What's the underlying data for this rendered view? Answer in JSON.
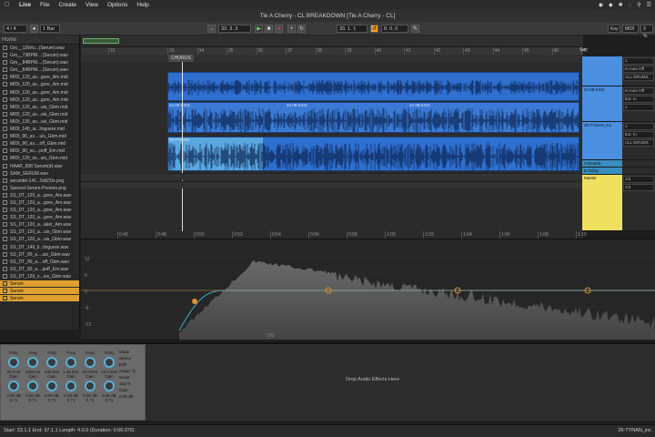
{
  "menubar": {
    "app": "Live",
    "items": [
      "File",
      "Create",
      "View",
      "Options",
      "Help"
    ]
  },
  "window": {
    "title": "Tie A Cherry - CL BREAKDOWN  [Tie A Cherry - CL]"
  },
  "transport": {
    "signature": "4 / 4",
    "quantize": "1 Bar",
    "position": "33.  3.  3",
    "loop_start": "33.  1.  1",
    "loop_length": "8.  0.  0",
    "key_label": "Key",
    "midi_label": "MIDI",
    "cpu": "3 %"
  },
  "browser": {
    "place": "Home",
    "items": [
      "Gm__126#u...(Serum).wav",
      "Gm__73BPM....(Serum).wav",
      "Gm__84BPM....(Serum).wav",
      "Gm__84BPM....(Serum).wav",
      "MIDI_120_as...gore_Am.mid",
      "MIDI_120_as...gore_Am.mid",
      "MIDI_120_as...gore_Am.mid",
      "MIDI_120_as...gore_Am.mid",
      "MIDI_120_as...uis_Gbm.mid",
      "MIDI_120_as...uis_Gbm.mid",
      "MIDI_130_as...uis_Gbm.mid",
      "MIDI_140_ia...linguere.mid",
      "MIDI_90_as....uis_Gbm.mid",
      "MIDI_90_as....off_Gbm.mid",
      "MIDI_90_ss....poff_Em.mid",
      "MIDI_120_ss...uis_Gbm.mid",
      "HAAR_808 Serum(d).wav",
      "SAM_SERUM.wav",
      "serumkit-141...5dt23lo.png",
      "Speced-Serum-Presets.png",
      "SS_DT_120_a...gore_Am.wav",
      "SS_DT_120_a...gore_Am.wav",
      "SS_DT_120_a...gore_Am.wav",
      "SS_DT_120_a...gore_Am.wav",
      "SS_DT_120_a...aker_Am.wav",
      "SS_DT_120_a...uis_Gbm.wav",
      "SS_DT_120_a...uis_Gbm.wav",
      "SS_DT_140_li...linguere.wav",
      "SS_DT_90_a....uis_Gbm.wav",
      "SS_DT_90_a....off_Gbm.wav",
      "SS_DT_90_a....poff_Em.wav",
      "SS_DT_120_s...uis_Gbm.wav",
      "Serum",
      "Serum",
      "Serum"
    ],
    "selected_index": 32
  },
  "arrangement": {
    "ruler": [
      "31",
      "33",
      "35",
      "37",
      "39",
      "41",
      "43",
      "45",
      "47"
    ],
    "ruler_extra": [
      "34",
      "36",
      "38",
      "40",
      "42",
      "44",
      "46"
    ],
    "locator": "CHORUS",
    "set_label": "Set",
    "clip_labels": {
      "kick_a": "24 08 KICK",
      "kick_b": "24 08 KICK",
      "kick_c": "24 08 KICK",
      "tynan": "26-TYNAN"
    },
    "time_labels": [
      "0:46",
      "0:48",
      "0:50",
      "0:52",
      "0:54",
      "0:56",
      "0:58",
      "1:00",
      "1:02",
      "1:04",
      "1:06",
      "1:08",
      "1:10"
    ]
  },
  "tracks": [
    {
      "name": "",
      "color": "#4a8fe0",
      "in": "In  Auto  Off",
      "route": "ALL DRUMS",
      "num": "1"
    },
    {
      "name": "24 08 KICK",
      "color": "#4a8fe0",
      "in": "Ext. In",
      "route": "1",
      "num": "In  Auto  Off"
    },
    {
      "name": "26-TYNAN_inc",
      "color": "#4a8fe0",
      "in": "Ext. In",
      "route": "ALL DRUMS",
      "num": "1"
    },
    {
      "name": "A Reverb",
      "color": "#3a8ec0",
      "in": "",
      "route": "",
      "num": ""
    },
    {
      "name": "B Delay",
      "color": "#3a8ec0",
      "in": "",
      "route": "",
      "num": ""
    },
    {
      "name": "Master",
      "color": "#f0e060",
      "in": "1/2",
      "route": "1/2",
      "num": ""
    }
  ],
  "eq": {
    "freq_label": "100",
    "db_labels": [
      "12",
      "6",
      "0",
      "-6",
      "-12"
    ]
  },
  "device": {
    "bands": [
      {
        "title": "Freq",
        "freq": "30.0 Hz",
        "gain": "Gain",
        "gval": "0.00 dB",
        "q": "0.71"
      },
      {
        "title": "Freq",
        "freq": "1000 Hz",
        "gain": "Gain",
        "gval": "0.00 dB",
        "q": "0.71"
      },
      {
        "title": "Freq",
        "freq": "100 kHz",
        "gain": "Gain",
        "gval": "0.00 dB",
        "q": "0.71"
      },
      {
        "title": "Freq",
        "freq": "1.00 kHz",
        "gain": "Gain",
        "gval": "0.00 dB",
        "q": "0.71"
      },
      {
        "title": "Freq",
        "freq": "10.0 kHz",
        "gain": "Gain",
        "gval": "0.00 dB",
        "q": "0.71"
      },
      {
        "title": "Freq",
        "freq": "10.0 kHz",
        "gain": "Gain",
        "gval": "0.00 dB",
        "q": "0.71"
      }
    ],
    "mode_label": "Mode",
    "mode_value": "Stereo",
    "edit_label": "Edit",
    "adapt_label": "Adapt. Q",
    "scale_label": "Scale",
    "scale_value": "100 %",
    "gain_label": "Gain",
    "gain_value": "0.00 dB",
    "drop_text": "Drop Audio Effects Here"
  },
  "status": {
    "left": "Start: 33.1.1    End: 37.1.1    Length: 4.0.0 (Duration: 0:06:076)",
    "right": "26-TYNAN_inc"
  },
  "colors": {
    "clip_blue": "#2f6fd0",
    "clip_lightblue": "#5aa7e0",
    "master_yellow": "#f0e060",
    "accent_orange": "#f0a030"
  }
}
